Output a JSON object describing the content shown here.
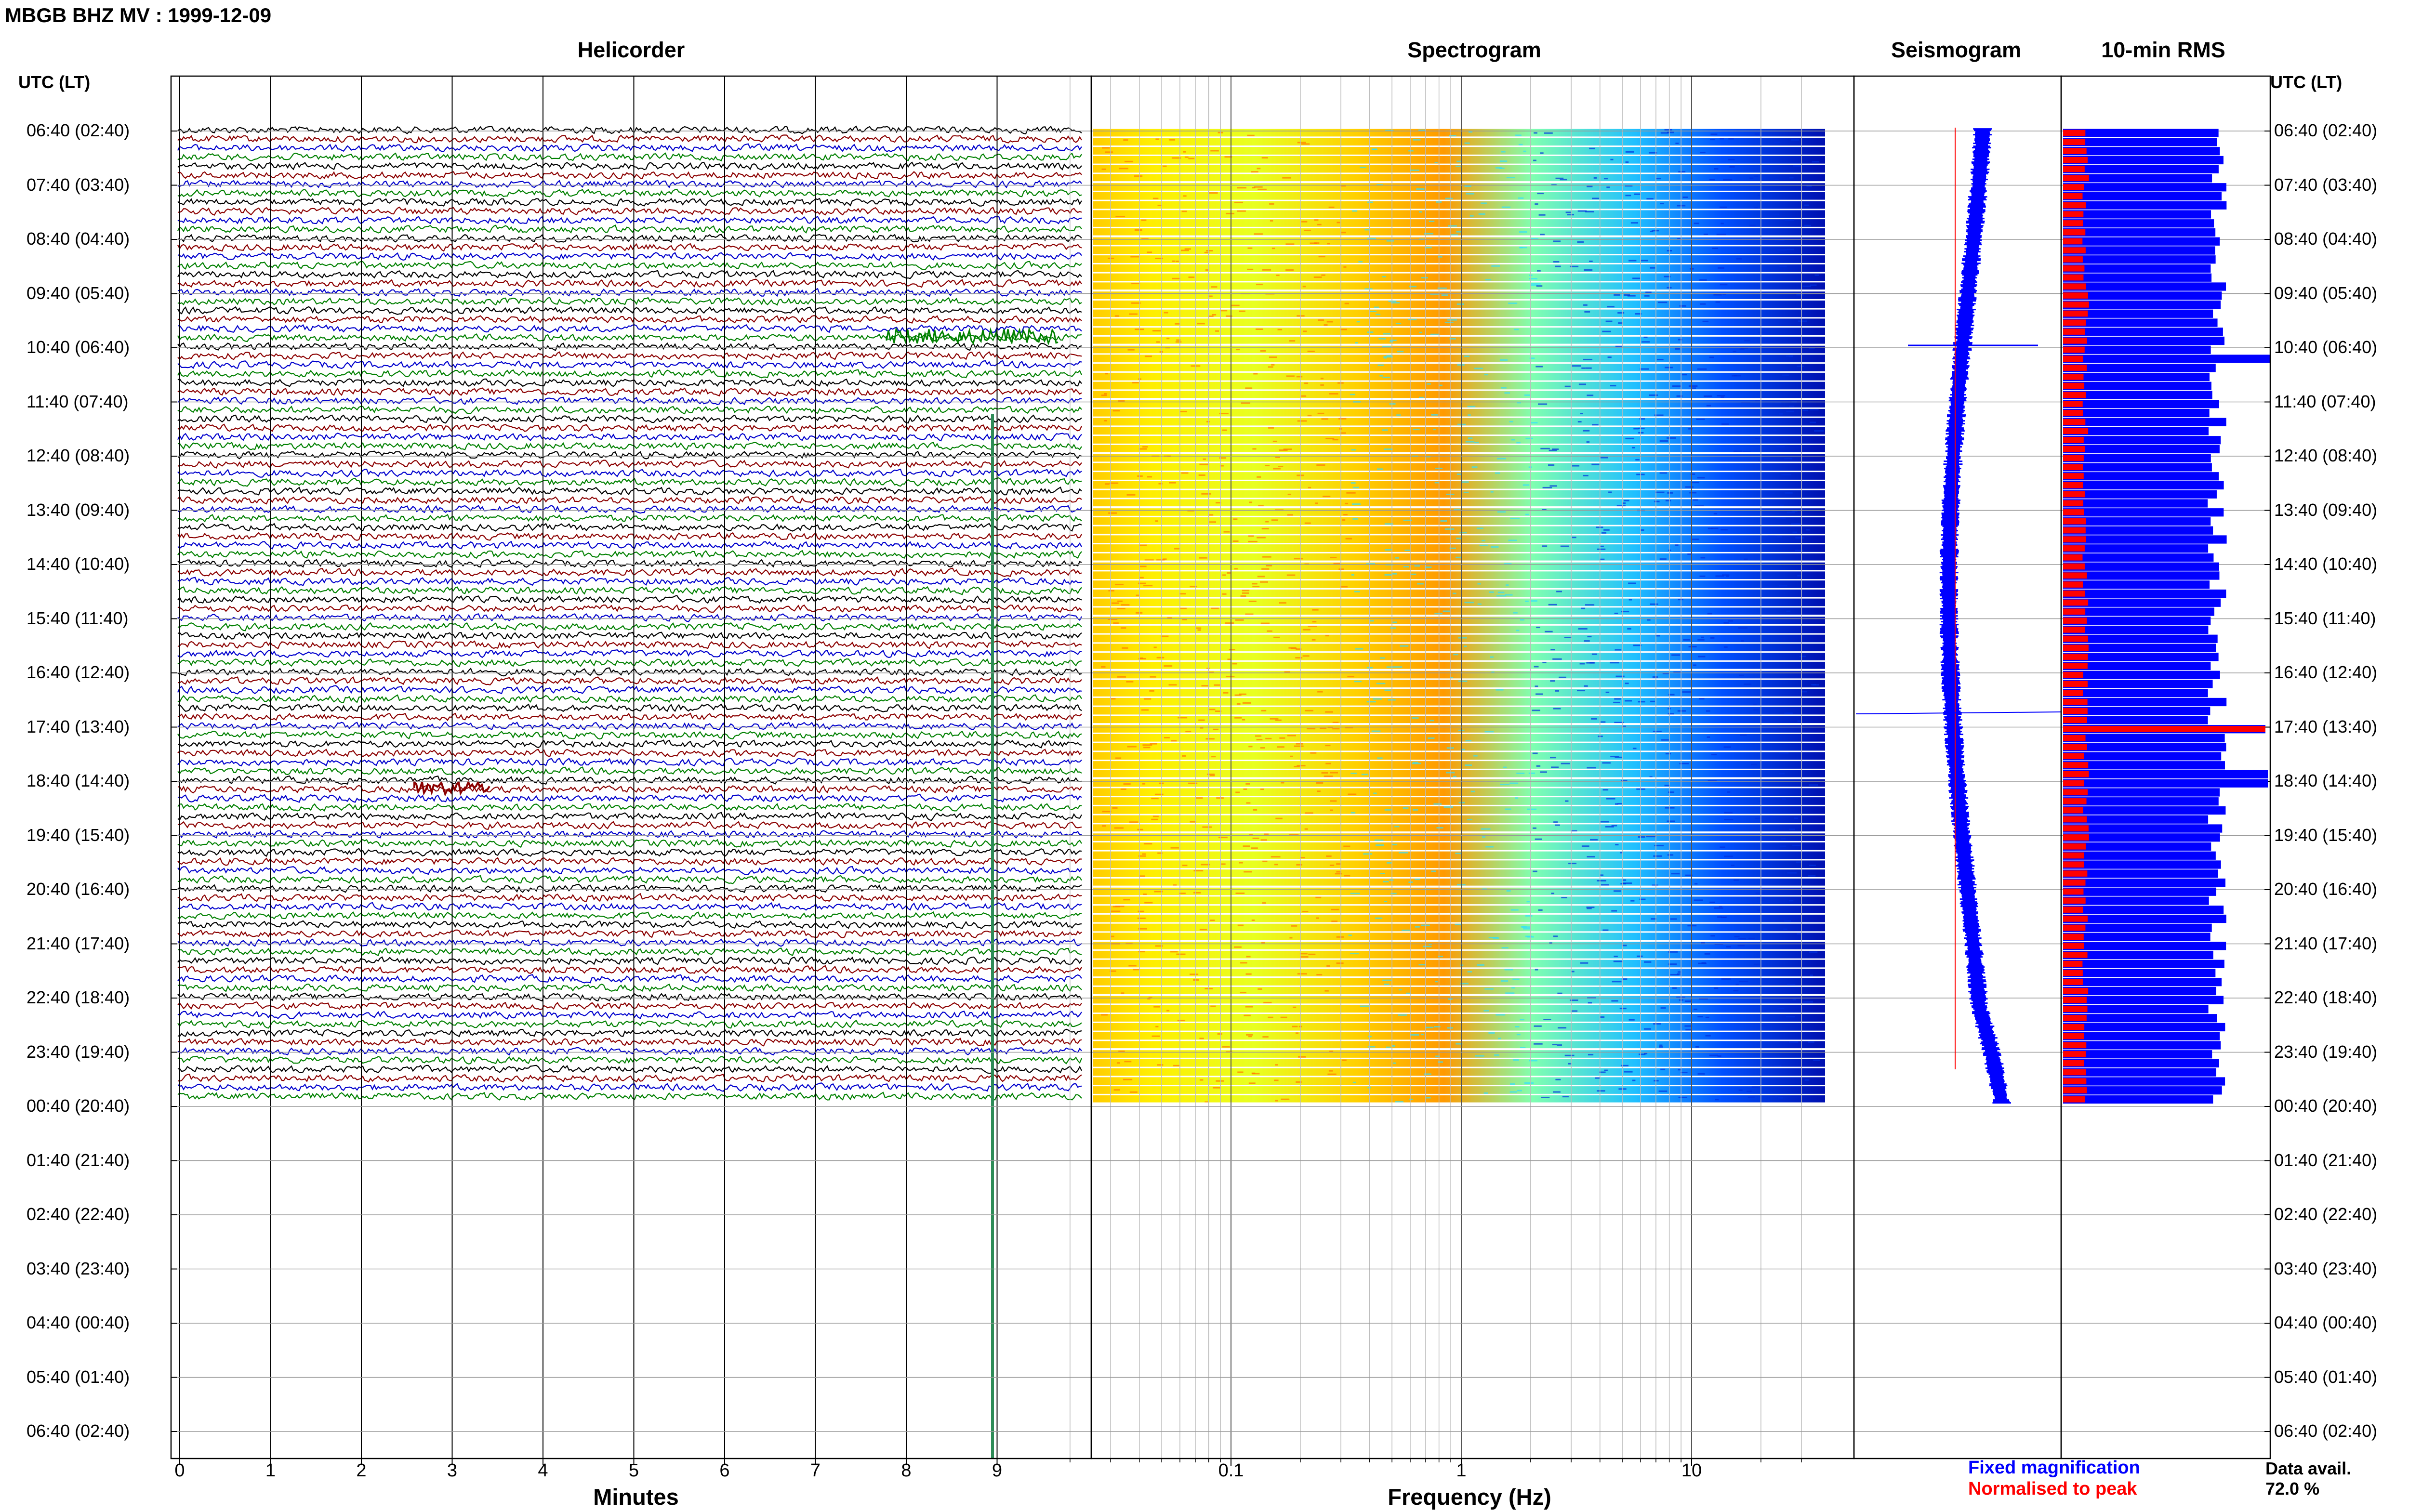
{
  "header": {
    "title": "MBGB BHZ MV : 1999-12-09"
  },
  "panels": {
    "helicorder": "Helicorder",
    "spectrogram": "Spectrogram",
    "seismogram": "Seismogram",
    "rms": "10-min RMS"
  },
  "axes": {
    "left_header": "UTC (LT)",
    "right_header": "UTC (LT)",
    "minutes_title": "Minutes",
    "frequency_title": "Frequency (Hz)"
  },
  "time_labels": [
    "06:40 (02:40)",
    "07:40 (03:40)",
    "08:40 (04:40)",
    "09:40 (05:40)",
    "10:40 (06:40)",
    "11:40 (07:40)",
    "12:40 (08:40)",
    "13:40 (09:40)",
    "14:40 (10:40)",
    "15:40 (11:40)",
    "16:40 (12:40)",
    "17:40 (13:40)",
    "18:40 (14:40)",
    "19:40 (15:40)",
    "20:40 (16:40)",
    "21:40 (17:40)",
    "22:40 (18:40)",
    "23:40 (19:40)",
    "00:40 (20:40)",
    "01:40 (21:40)",
    "02:40 (22:40)",
    "03:40 (23:40)",
    "04:40 (00:40)",
    "05:40 (01:40)",
    "06:40 (02:40)"
  ],
  "minute_ticks": [
    "0",
    "1",
    "2",
    "3",
    "4",
    "5",
    "6",
    "7",
    "8",
    "9"
  ],
  "frequency_ticks": [
    "0.1",
    "1",
    "10"
  ],
  "legend": {
    "fixed": "Fixed magnification",
    "normalised": "Normalised to peak",
    "fixed_color": "#0000ff",
    "normalised_color": "#ff0000"
  },
  "availability": {
    "label": "Data avail.",
    "value": "72.0 %"
  },
  "colors": {
    "trace_cycle": [
      "#000000",
      "#8b0000",
      "#0000cd",
      "#008000"
    ],
    "spectrogram_scale": [
      "#00007f",
      "#0000ff",
      "#00a0ff",
      "#40ffc0",
      "#c0ff40",
      "#ffff00",
      "#ff8000",
      "#ff0000"
    ]
  },
  "chart_data": {
    "type": "heatmap",
    "title": "MBGB BHZ MV : 1999-12-09",
    "rows_per_hour": 6,
    "hours_with_data": 18,
    "hours_total": 24,
    "data_availability_percent": 72.0,
    "helicorder": {
      "xlabel": "Minutes",
      "xlim": [
        0,
        10
      ]
    },
    "spectrogram": {
      "xlabel": "Frequency (Hz)",
      "xscale": "log",
      "xlim": [
        0.02,
        40
      ]
    },
    "rms_10min": {
      "series": [
        {
          "name": "Fixed magnification",
          "color": "#0000ff"
        },
        {
          "name": "Normalised to peak",
          "color": "#ff0000"
        }
      ]
    }
  }
}
